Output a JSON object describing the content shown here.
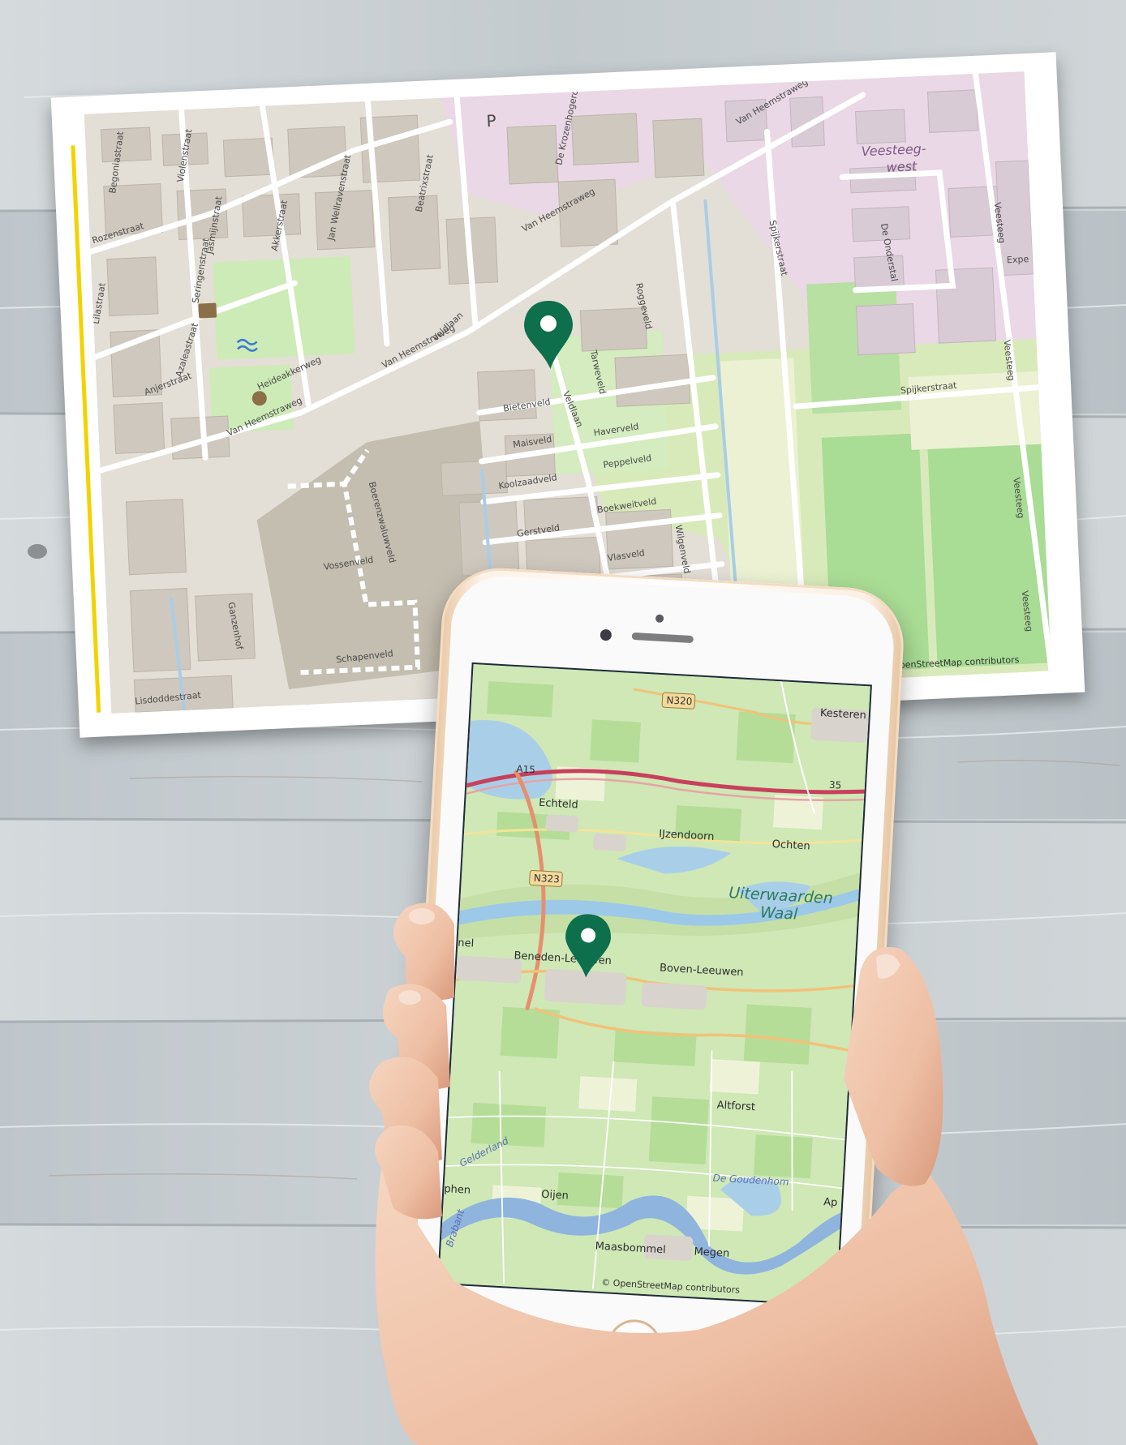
{
  "postcard_map": {
    "streets": [
      "Begoniastraat",
      "Violenstraat",
      "Rozenstraat",
      "Jasmijnstraat",
      "Seringenstraat",
      "Jan Wellravenstraat",
      "Akkerstraat",
      "Beatrixstraat",
      "De Krozenhogerd",
      "Van Heemstraweg",
      "Lilastraat",
      "Azaleastraat",
      "Heideakkerweg",
      "Anjerstraat",
      "Veldlaan",
      "Tarweveld",
      "Roggeveld",
      "Bietenveld",
      "Haverveld",
      "Maisveld",
      "Koolzaadveld",
      "Peppelveld",
      "Gerstveld",
      "Boekweitveld",
      "Vlasveld",
      "Wilgenveld",
      "Vossenveld",
      "Boerenzwaluwveld",
      "Schapenveld",
      "Ganzenhof",
      "Lisdoddestraat",
      "Spijkerstraat",
      "De Onderstal",
      "Veesteeg",
      "Expe"
    ],
    "area_name_line1": "Veesteeg-",
    "area_name_line2": "west",
    "parking": "P",
    "attribution": "© OpenStreetMap contributors",
    "marker_color": "#0e6f4d",
    "accent_color": "#f2d300"
  },
  "phone_map": {
    "places": [
      "Kesteren",
      "Echteld",
      "IJzendoorn",
      "Ochten",
      "Beneden-Leeuwen",
      "Boven-Leeuwen",
      "Altforst",
      "Oijen",
      "Maasbommel",
      "Megen",
      "phen",
      "nel",
      "Ap"
    ],
    "water_label_line1": "Uiterwaarden",
    "water_label_line2": "Waal",
    "lake_label": "De Goudenhom",
    "province_gelderland": "Gelderland",
    "province_brabant": "Brabant",
    "road_shields": [
      "N320",
      "N323",
      "A15",
      "35"
    ],
    "attribution": "© OpenStreetMap contributors",
    "marker_color": "#0e6f4d"
  }
}
